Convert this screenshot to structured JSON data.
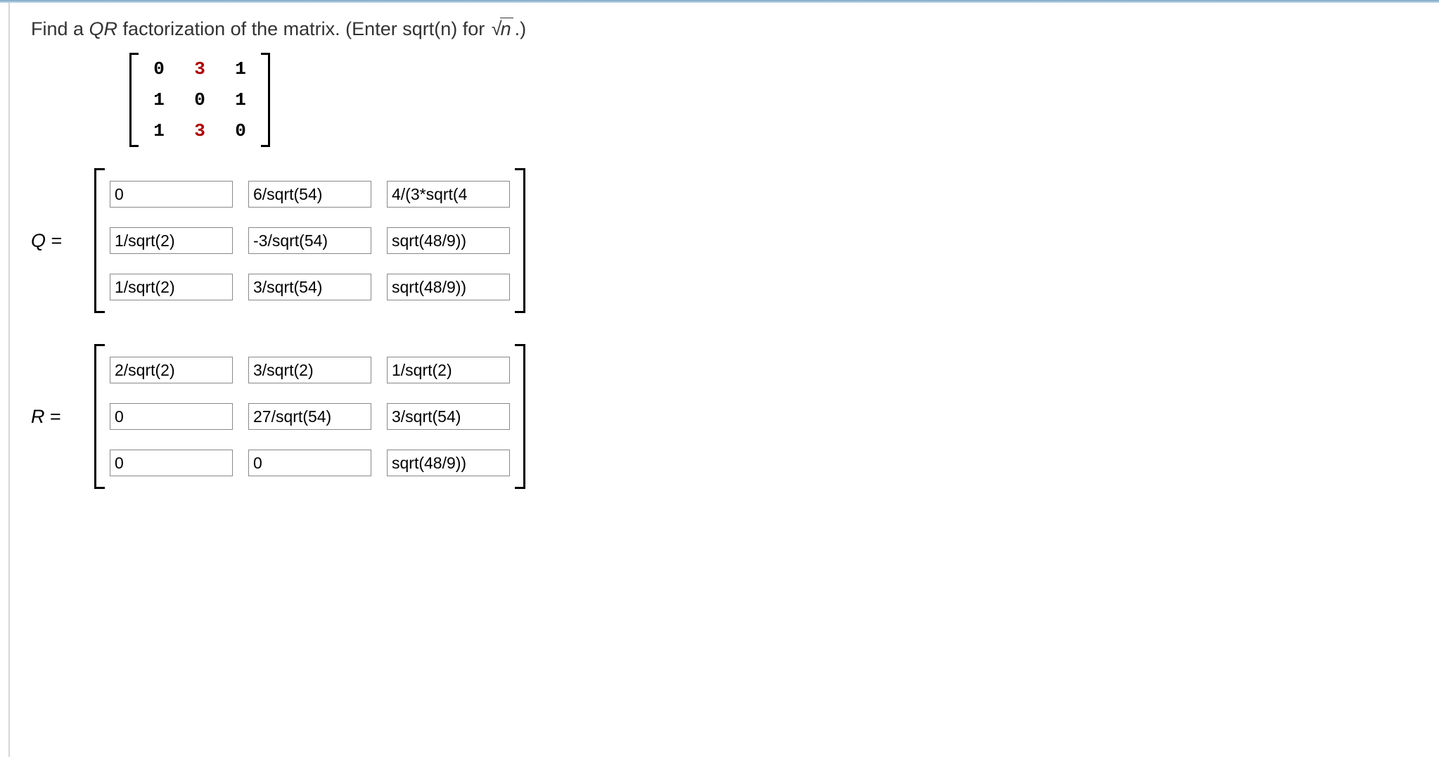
{
  "prompt": {
    "text_before": "Find a ",
    "qr": "QR",
    "text_mid": " factorization of the matrix. (Enter sqrt(n) for ",
    "radicand": "n",
    "text_after": ".)"
  },
  "given_matrix": {
    "rows": [
      [
        "0",
        "3",
        "1"
      ],
      [
        "1",
        "0",
        "1"
      ],
      [
        "1",
        "3",
        "0"
      ]
    ],
    "highlight": [
      [
        0,
        1
      ],
      [
        2,
        1
      ]
    ]
  },
  "Q": {
    "label": "Q",
    "values": [
      [
        "0",
        "6/sqrt(54)",
        "4/(3*sqrt(4"
      ],
      [
        "1/sqrt(2)",
        "-3/sqrt(54)",
        "sqrt(48/9))"
      ],
      [
        "1/sqrt(2)",
        "3/sqrt(54)",
        "sqrt(48/9))"
      ]
    ]
  },
  "R": {
    "label": "R",
    "values": [
      [
        "2/sqrt(2)",
        "3/sqrt(2)",
        "1/sqrt(2)"
      ],
      [
        "0",
        "27/sqrt(54)",
        "3/sqrt(54)"
      ],
      [
        "0",
        "0",
        "sqrt(48/9))"
      ]
    ]
  }
}
